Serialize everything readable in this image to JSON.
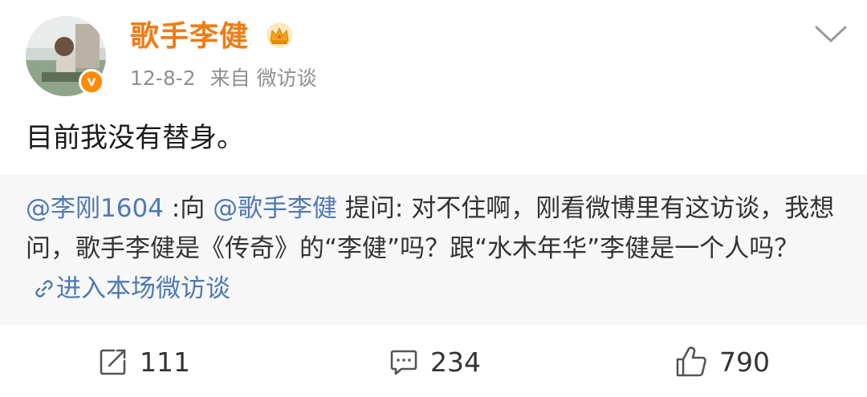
{
  "user": {
    "name": "歌手李健",
    "date": "12-8-2",
    "source": "来自 微访谈",
    "badge": "v"
  },
  "post": {
    "text": "目前我没有替身。"
  },
  "quote": {
    "mention_author": "@李刚1604",
    "connector": " :向 ",
    "mention_target": "@歌手李健",
    "question": " 提问: 对不住啊，刚看微博里有这访谈，我想问，歌手李健是《传奇》的“李健”吗？跟“水木年华”李健是一个人吗？",
    "link_text": "进入本场微访谈"
  },
  "actions": {
    "repost_count": "111",
    "comment_count": "234",
    "like_count": "790"
  },
  "colors": {
    "name": "#ef7c14",
    "mention": "#4f79b3",
    "quote_bg": "#f7f7f7",
    "badge": "#ff8a00"
  },
  "icons": {
    "crown": "crown-icon",
    "more": "chevron-down-icon",
    "link": "link-icon",
    "repost": "repost-icon",
    "comment": "comment-icon",
    "like": "thumbs-up-icon"
  }
}
